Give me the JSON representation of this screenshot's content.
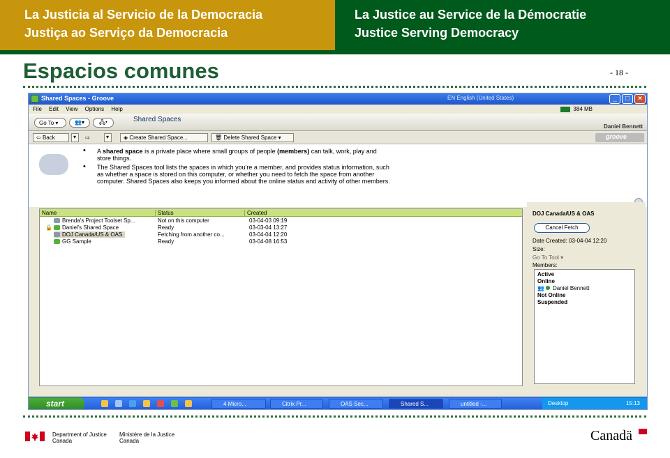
{
  "header": {
    "left_lines": [
      "La Justicia al Servicio de la Democracia",
      "Justiça ao Serviço da Democracia"
    ],
    "right_lines": [
      "La Justice au Service de la Démocratie",
      "Justice Serving Democracy"
    ]
  },
  "slide": {
    "title": "Espacios comunes",
    "page_number": "- 18 -"
  },
  "window": {
    "title": "Shared Spaces - Groove",
    "language": "EN English (United States)",
    "menu": [
      "File",
      "Edit",
      "View",
      "Options",
      "Help"
    ],
    "memory": "384 MB",
    "goto_label": "Go To",
    "tab_title": "Shared Spaces",
    "user_name": "Daniel Bennett",
    "toolbar": {
      "back": "Back",
      "create": "Create Shared Space...",
      "delete": "Delete Shared Space"
    },
    "brand": "groove",
    "info": {
      "bullet1_pre": "A ",
      "bullet1_b1": "shared space",
      "bullet1_mid": " is a private place where small groups of people ",
      "bullet1_b2": "(members)",
      "bullet1_post": " can talk, work, play and store things.",
      "bullet2": "The Shared Spaces tool lists the spaces in which you're a member, and provides status information, such as whether a space is stored on this computer, or whether you need to fetch the space from another computer. Shared Spaces also keeps you informed about the online status and activity of other members."
    },
    "list": {
      "columns": [
        "Name",
        "Status",
        "Created"
      ],
      "rows": [
        {
          "name": "Brenda's Project Toolset Sp...",
          "status": "Not on this computer",
          "created": "03-04-03 09:19"
        },
        {
          "name": "Daniel's Shared Space",
          "status": "Ready",
          "created": "03-03-04 13:27"
        },
        {
          "name": "DOJ Canada/US & OAS",
          "status": "Fetching from another co...",
          "created": "03-04-04 12:20"
        },
        {
          "name": "GG Sample",
          "status": "Ready",
          "created": "03-04-08 16:53"
        }
      ]
    },
    "detail": {
      "title": "DOJ Canada/US & OAS",
      "cancel_button": "Cancel Fetch",
      "date_created": "Date Created: 03-04-04 12:20",
      "size": "Size:",
      "goto_tool": "Go To Tool",
      "members_label": "Members:",
      "active": "Active",
      "online": "Online",
      "member": "Daniel Bennett",
      "not_online": "Not Online",
      "suspended": "Suspended"
    }
  },
  "taskbar": {
    "start": "start",
    "tasks": [
      "4 Micro...",
      "Citrix Pr...",
      "OAS Sec...",
      "Shared S...",
      "untitled -..."
    ],
    "desktop": "Desktop",
    "clock": "15:13"
  },
  "footer": {
    "dept_en": [
      "Department of Justice",
      "Canada"
    ],
    "dept_fr": [
      "Ministère de la Justice",
      "Canada"
    ],
    "wordmark": "Canadä"
  }
}
